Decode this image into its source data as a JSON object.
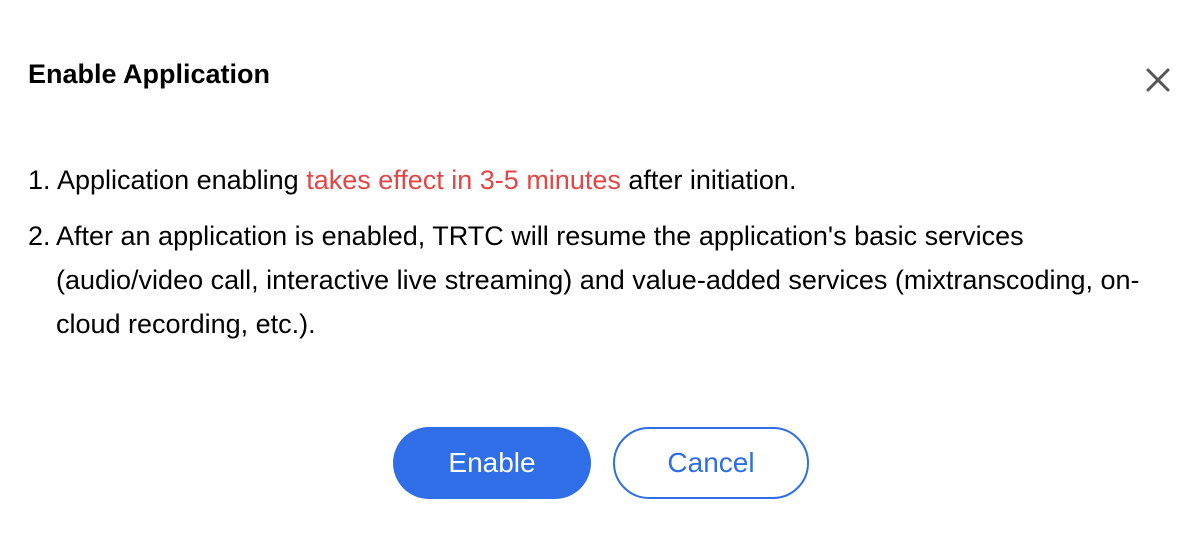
{
  "dialog": {
    "title": "Enable Application",
    "close_icon": "close-icon",
    "items": [
      {
        "number": "1.",
        "text_before": "Application enabling ",
        "highlight": "takes effect in 3-5 minutes",
        "text_after": " after initiation."
      },
      {
        "number": "2.",
        "text": "After an application is enabled, TRTC will resume the application's basic services (audio/video call, interactive live streaming) and value-added services (mixtranscoding, on-cloud recording, etc.)."
      }
    ],
    "buttons": {
      "confirm_label": "Enable",
      "cancel_label": "Cancel"
    }
  },
  "colors": {
    "accent": "#2f6ee6",
    "highlight": "#e54545",
    "text": "#000000",
    "background": "#ffffff"
  }
}
